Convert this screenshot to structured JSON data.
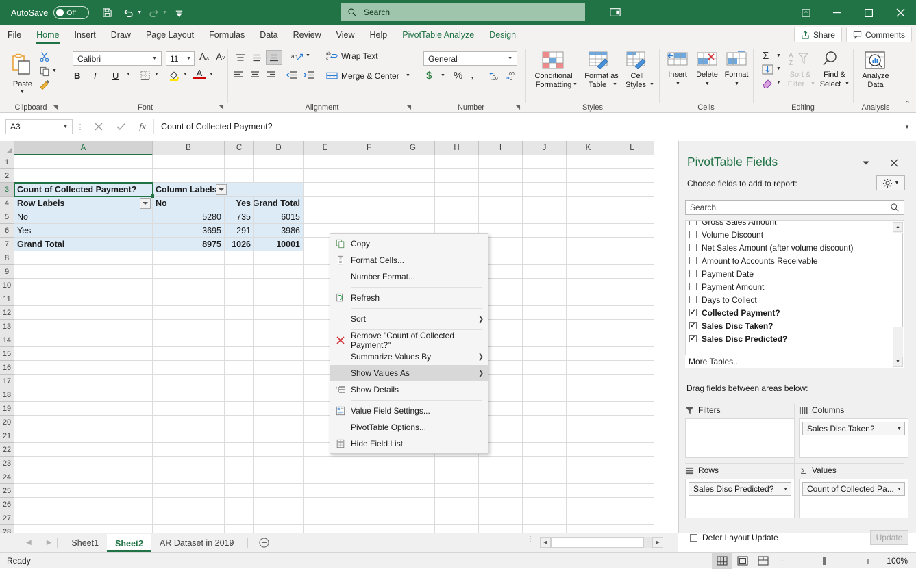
{
  "titlebar": {
    "autosave_label": "AutoSave",
    "autosave_state": "Off",
    "save_icon": "save-icon",
    "undo_icon": "undo-icon",
    "redo_icon": "redo-icon",
    "customize_icon": "customize-qat-icon",
    "search_placeholder": "Search",
    "search_icon": "search-icon",
    "ribbon_display_icon": "ribbon-display-options-icon",
    "minimize": "minimize-icon",
    "maximize": "maximize-icon",
    "close": "close-icon"
  },
  "ribbon_tabs": [
    {
      "label": "File",
      "style": "normal"
    },
    {
      "label": "Home",
      "style": "active"
    },
    {
      "label": "Insert",
      "style": "normal"
    },
    {
      "label": "Draw",
      "style": "normal"
    },
    {
      "label": "Page Layout",
      "style": "normal"
    },
    {
      "label": "Formulas",
      "style": "normal"
    },
    {
      "label": "Data",
      "style": "normal"
    },
    {
      "label": "Review",
      "style": "normal"
    },
    {
      "label": "View",
      "style": "normal"
    },
    {
      "label": "Help",
      "style": "normal"
    },
    {
      "label": "PivotTable Analyze",
      "style": "green"
    },
    {
      "label": "Design",
      "style": "green"
    }
  ],
  "header_buttons": {
    "share": "Share",
    "comments": "Comments"
  },
  "ribbon": {
    "clipboard": {
      "group_label": "Clipboard",
      "paste": "Paste",
      "cut_icon": "cut-scissors-icon",
      "copy_icon": "copy-icon",
      "format_painter_icon": "format-painter-icon"
    },
    "font": {
      "group_label": "Font",
      "font_name": "Calibri",
      "font_size": "11",
      "grow_font": "A",
      "shrink_font": "A",
      "bold": "B",
      "italic": "I",
      "underline": "U",
      "borders_icon": "borders-icon",
      "fill_color_icon": "fill-color-icon",
      "font_color_icon": "font-color-icon"
    },
    "alignment": {
      "group_label": "Alignment",
      "wrap_text": "Wrap Text",
      "merge_center": "Merge & Center",
      "orientation_icon": "text-orientation-icon"
    },
    "number": {
      "group_label": "Number",
      "format": "General",
      "accounting_icon": "currency-icon",
      "percent": "%",
      "comma": ",",
      "increase_decimal_icon": "increase-decimal-icon",
      "decrease_decimal_icon": "decrease-decimal-icon"
    },
    "styles": {
      "group_label": "Styles",
      "conditional_formatting": "Conditional\nFormatting",
      "conditional_formatting_l1": "Conditional",
      "conditional_formatting_l2": "Formatting",
      "format_as_table_l1": "Format as",
      "format_as_table_l2": "Table",
      "cell_styles_l1": "Cell",
      "cell_styles_l2": "Styles"
    },
    "cells": {
      "group_label": "Cells",
      "insert": "Insert",
      "delete": "Delete",
      "format": "Format"
    },
    "editing": {
      "group_label": "Editing",
      "autosum_icon": "autosum-sigma-icon",
      "fill_icon": "fill-down-icon",
      "clear_icon": "clear-eraser-icon",
      "sort_filter_l1": "Sort &",
      "sort_filter_l2": "Filter",
      "find_select_l1": "Find &",
      "find_select_l2": "Select"
    },
    "analysis": {
      "group_label": "Analysis",
      "analyze_data_l1": "Analyze",
      "analyze_data_l2": "Data"
    }
  },
  "formula_bar": {
    "name_box": "A3",
    "cancel_icon": "cancel-x-icon",
    "enter_icon": "enter-check-icon",
    "function_icon": "insert-function-icon",
    "formula": "Count of Collected Payment?"
  },
  "grid": {
    "columns": [
      "A",
      "B",
      "C",
      "D",
      "E",
      "F",
      "G",
      "H",
      "I",
      "J",
      "K",
      "L"
    ],
    "selected_column": "A",
    "rows": [
      "1",
      "2",
      "3",
      "4",
      "5",
      "6",
      "7",
      "8",
      "9",
      "10",
      "11",
      "12",
      "13",
      "14",
      "15",
      "16",
      "17",
      "18",
      "19",
      "20",
      "21",
      "22",
      "23",
      "24",
      "25",
      "26",
      "27",
      "28"
    ],
    "selected_row": "3",
    "active_cell": "A3",
    "pivot": {
      "title_cell": "Count of Collected Payment?",
      "column_labels": "Column Labels",
      "row_labels": "Row Labels",
      "col_headers": [
        "No",
        "Yes",
        "Grand Total"
      ],
      "rows": [
        {
          "label": "No",
          "values": [
            "5280",
            "735",
            "6015"
          ],
          "bold": false
        },
        {
          "label": "Yes",
          "values": [
            "3695",
            "291",
            "3986"
          ],
          "bold": false
        },
        {
          "label": "Grand Total",
          "values": [
            "8975",
            "1026",
            "10001"
          ],
          "bold": true
        }
      ]
    }
  },
  "context_menu": {
    "items": [
      {
        "label": "Copy",
        "icon": "copy-icon",
        "submenu": false,
        "highlighted": false,
        "sep_after": false
      },
      {
        "label": "Format Cells...",
        "icon": "format-cells-icon",
        "submenu": false,
        "highlighted": false,
        "sep_after": false
      },
      {
        "label": "Number Format...",
        "icon": "",
        "submenu": false,
        "highlighted": false,
        "sep_after": true
      },
      {
        "label": "Refresh",
        "icon": "refresh-icon",
        "submenu": false,
        "highlighted": false,
        "sep_after": true
      },
      {
        "label": "Sort",
        "icon": "",
        "submenu": true,
        "highlighted": false,
        "sep_after": true
      },
      {
        "label": "Remove \"Count of Collected Payment?\"",
        "icon": "remove-x-icon",
        "submenu": false,
        "highlighted": false,
        "sep_after": false
      },
      {
        "label": "Summarize Values By",
        "icon": "",
        "submenu": true,
        "highlighted": false,
        "sep_after": false
      },
      {
        "label": "Show Values As",
        "icon": "",
        "submenu": true,
        "highlighted": true,
        "sep_after": false
      },
      {
        "label": "Show Details",
        "icon": "show-details-icon",
        "submenu": false,
        "highlighted": false,
        "sep_after": true
      },
      {
        "label": "Value Field Settings...",
        "icon": "value-field-settings-icon",
        "submenu": false,
        "highlighted": false,
        "sep_after": false
      },
      {
        "label": "PivotTable Options...",
        "icon": "",
        "submenu": false,
        "highlighted": false,
        "sep_after": false
      },
      {
        "label": "Hide Field List",
        "icon": "hide-field-list-icon",
        "submenu": false,
        "highlighted": false,
        "sep_after": false
      }
    ]
  },
  "pane": {
    "title": "PivotTable Fields",
    "dropdown_icon": "chevron-down-icon",
    "close_icon": "close-icon",
    "subtitle": "Choose fields to add to report:",
    "tools_icon": "gear-icon",
    "search_placeholder": "Search",
    "search_icon": "search-icon",
    "fields": [
      {
        "label": "Gross Sales Amount",
        "checked": false,
        "clipped": true
      },
      {
        "label": "Volume Discount",
        "checked": false,
        "clipped": false
      },
      {
        "label": "Net Sales Amount (after volume discount)",
        "checked": false,
        "clipped": false
      },
      {
        "label": "Amount to Accounts Receivable",
        "checked": false,
        "clipped": false
      },
      {
        "label": "Payment Date",
        "checked": false,
        "clipped": false
      },
      {
        "label": "Payment Amount",
        "checked": false,
        "clipped": false
      },
      {
        "label": "Days to Collect",
        "checked": false,
        "clipped": false
      },
      {
        "label": "Collected Payment?",
        "checked": true,
        "clipped": false
      },
      {
        "label": "Sales Disc Taken?",
        "checked": true,
        "clipped": false
      },
      {
        "label": "Sales Disc Predicted?",
        "checked": true,
        "clipped": false
      }
    ],
    "more_tables": "More Tables...",
    "drag_title": "Drag fields between areas below:",
    "zones": [
      {
        "name": "Filters",
        "icon": "filter-funnel-icon",
        "chips": []
      },
      {
        "name": "Columns",
        "icon": "columns-icon",
        "chips": [
          "Sales Disc Taken?"
        ]
      },
      {
        "name": "Rows",
        "icon": "rows-icon",
        "chips": [
          "Sales Disc Predicted?"
        ]
      },
      {
        "name": "Values",
        "icon": "sigma-icon",
        "chips": [
          "Count of Collected Pa..."
        ]
      }
    ],
    "defer_label": "Defer Layout Update",
    "update_button": "Update"
  },
  "sheet_tabs": {
    "prev_icon": "prev-sheet-icon",
    "next_icon": "next-sheet-icon",
    "tabs": [
      {
        "label": "Sheet1",
        "active": false
      },
      {
        "label": "Sheet2",
        "active": true
      },
      {
        "label": "AR Dataset in 2019",
        "active": false
      }
    ],
    "add_icon": "add-sheet-icon"
  },
  "status_bar": {
    "status": "Ready",
    "normal_view_icon": "normal-view-icon",
    "page_layout_icon": "page-layout-view-icon",
    "page_break_icon": "page-break-view-icon",
    "zoom_out": "−",
    "zoom_in": "+",
    "zoom_level": "100%"
  }
}
